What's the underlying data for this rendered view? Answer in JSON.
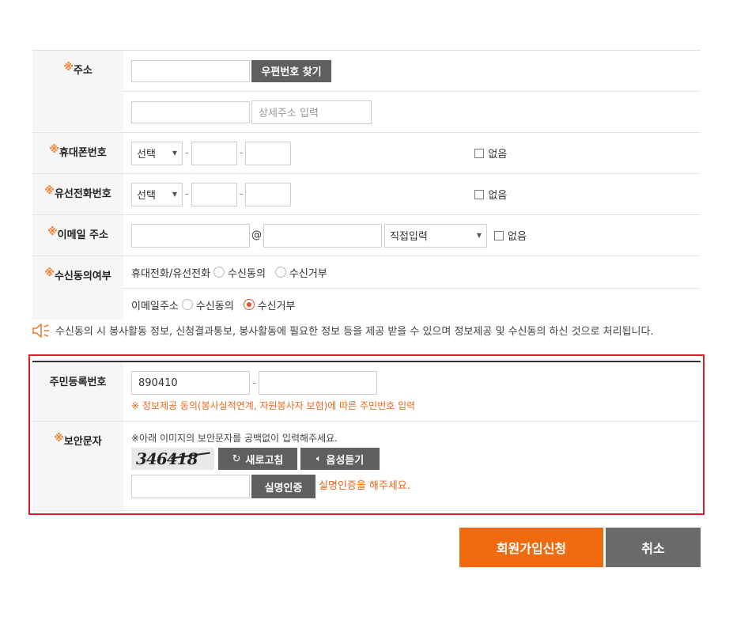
{
  "address": {
    "label": "주소",
    "postcode_button": "우편번호 찾기",
    "detail_placeholder": "상세주소 입력"
  },
  "mobile": {
    "label": "휴대폰번호",
    "select_value": "선택",
    "none_label": "없음"
  },
  "landline": {
    "label": "유선전화번호",
    "select_value": "선택",
    "none_label": "없음"
  },
  "email": {
    "label": "이메일 주소",
    "at": "@",
    "domain_select": "직접입력",
    "none_label": "없음"
  },
  "consent": {
    "label": "수신동의여부",
    "phone_label": "휴대전화/유선전화",
    "email_label": "이메일주소",
    "agree": "수신동의",
    "reject": "수신거부"
  },
  "notice": "수신동의 시 봉사활동 정보, 신청결과통보, 봉사활동에 필요한 정보 등을 제공 받을 수 있으며 정보제공 및 수신동의 하신 것으로 처리됩니다.",
  "resident": {
    "label": "주민등록번호",
    "first_value": "890410",
    "dash": "-",
    "note": "※ 정보제공 동의(봉사실적연계, 자원봉사자 보험)에 따른 주민번호 입력"
  },
  "captcha": {
    "label": "보안문자",
    "instruction": "※아래 이미지의 보안문자를 공백없이 입력해주세요.",
    "image_text": "346418",
    "refresh_button": "새로고침",
    "audio_button": "음성듣기",
    "verify_button": "실명인증",
    "status": "실명인증을 해주세요."
  },
  "req_mark": "※",
  "actions": {
    "submit": "회원가입신청",
    "cancel": "취소"
  },
  "colors": {
    "accent_orange": "#f06a10",
    "required_orange": "#f07c2c",
    "highlight_red": "#d9202a",
    "button_gray": "#5f5f5f"
  }
}
